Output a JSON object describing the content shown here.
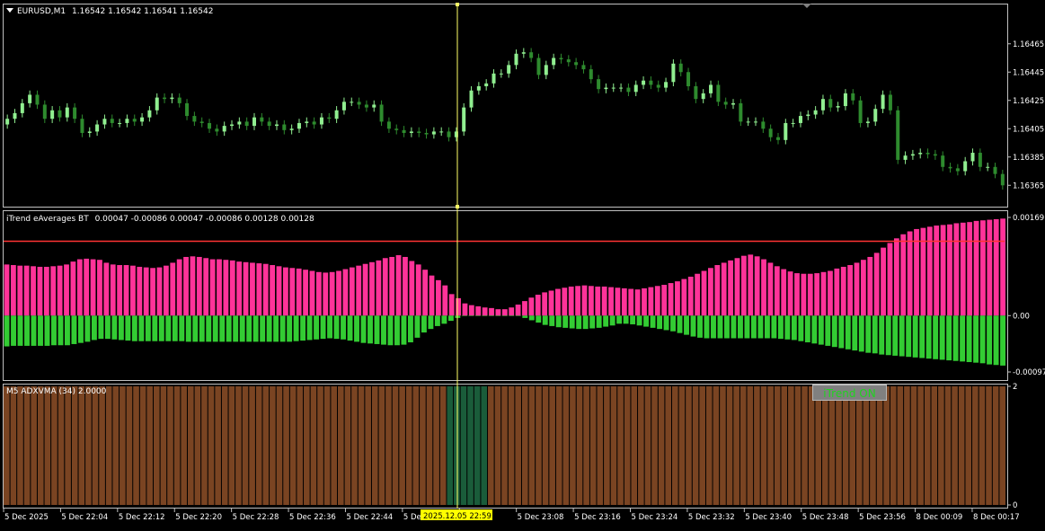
{
  "colors": {
    "background": "#000000",
    "frame": "#c0c0c0",
    "text": "#ffffff",
    "bull_candle": "#90ee90",
    "bear_candle": "#2e8b2e",
    "crosshair": "#ffff66",
    "pink_histogram": "#ff3399",
    "green_histogram": "#33cc33",
    "level_line": "#ff3333",
    "adx_bar": "#7a4422",
    "adx_bar_highlight": "#1a5c3a",
    "button_text": "#1fd41f",
    "time_highlight": "#ffff00"
  },
  "chart_data": [
    {
      "type": "candlestick",
      "symbol": "EURUSD,M1",
      "ohlc_header": "1.16542 1.16542 1.16541 1.16542",
      "ylim": [
        1.16355,
        1.16475
      ],
      "y_ticks": [
        "1.16465",
        "1.16445",
        "1.16425",
        "1.16405",
        "1.16385",
        "1.16365"
      ],
      "close": [
        1.16412,
        1.16416,
        1.16423,
        1.16429,
        1.16422,
        1.16412,
        1.16418,
        1.16413,
        1.1642,
        1.16412,
        1.16402,
        1.16403,
        1.16408,
        1.16412,
        1.16409,
        1.16409,
        1.16412,
        1.1641,
        1.16413,
        1.16418,
        1.16427,
        1.16426,
        1.16427,
        1.16423,
        1.16414,
        1.1641,
        1.16409,
        1.16405,
        1.16403,
        1.16407,
        1.16408,
        1.1641,
        1.16407,
        1.16413,
        1.1641,
        1.16407,
        1.16408,
        1.16404,
        1.16405,
        1.16409,
        1.1641,
        1.16408,
        1.16413,
        1.16412,
        1.16418,
        1.16424,
        1.16424,
        1.16422,
        1.1642,
        1.16422,
        1.1641,
        1.16405,
        1.16404,
        1.16402,
        1.16403,
        1.16402,
        1.16401,
        1.16403,
        1.16403,
        1.16399,
        1.16403,
        1.1642,
        1.16432,
        1.16435,
        1.16437,
        1.16444,
        1.16444,
        1.1645,
        1.16458,
        1.16459,
        1.16455,
        1.16443,
        1.1645,
        1.16455,
        1.16454,
        1.16452,
        1.1645,
        1.16447,
        1.1644,
        1.16433,
        1.16434,
        1.16434,
        1.16434,
        1.16431,
        1.16436,
        1.16439,
        1.16436,
        1.16434,
        1.16438,
        1.16451,
        1.16445,
        1.16435,
        1.16426,
        1.1643,
        1.16436,
        1.16424,
        1.16422,
        1.16423,
        1.1641,
        1.1641,
        1.1641,
        1.16405,
        1.16399,
        1.16397,
        1.16409,
        1.16409,
        1.16414,
        1.16415,
        1.16418,
        1.16426,
        1.1642,
        1.16421,
        1.1643,
        1.16425,
        1.16409,
        1.1641,
        1.16419,
        1.16429,
        1.16418,
        1.16383,
        1.16386,
        1.16387,
        1.16388,
        1.16387,
        1.16386,
        1.16378,
        1.16377,
        1.16375,
        1.16382,
        1.16388,
        1.16378,
        1.16378,
        1.16373,
        1.16365
      ]
    },
    {
      "type": "bar",
      "indicator": "iTrend eAverages BT",
      "values_header": "0.00047 -0.00086 0.00047 -0.00086 0.00128 0.00128",
      "ylim": [
        -0.00097,
        0.00169
      ],
      "y_ticks": [
        "0.00169",
        "0.00",
        "-0.00097"
      ],
      "level_line": 0.00128,
      "series": [
        {
          "values": [
            0.00088,
            0.00087,
            0.00086,
            0.00086,
            0.00085,
            0.00084,
            0.00084,
            0.00085,
            0.00086,
            0.00088,
            0.00093,
            0.00097,
            0.00098,
            0.00097,
            0.00096,
            0.00091,
            0.00088,
            0.00087,
            0.00087,
            0.00086,
            0.00084,
            0.00083,
            0.00082,
            0.00083,
            0.00086,
            0.00091,
            0.00097,
            0.00101,
            0.00102,
            0.00101,
            0.00099,
            0.00097,
            0.00097,
            0.00096,
            0.00095,
            0.00093,
            0.00092,
            0.00091,
            0.0009,
            0.00089,
            0.00087,
            0.00085,
            0.00083,
            0.00082,
            0.00081,
            0.00079,
            0.00077,
            0.00075,
            0.00074,
            0.00075,
            0.00077,
            0.0008,
            0.00083,
            0.00086,
            0.00089,
            0.00092,
            0.00095,
            0.00099,
            0.00101,
            0.00104,
            0.00101,
            0.00094,
            0.00088,
            0.00079,
            0.00069,
            0.00061,
            0.00052,
            0.00037,
            0.0003,
            0.00021,
            0.00018,
            0.00016,
            0.00014,
            0.00013,
            0.00011,
            0.00011,
            0.00014,
            0.00019,
            0.00025,
            0.00031,
            0.00036,
            0.0004,
            0.00043,
            0.00046,
            0.00048,
            0.0005,
            0.00051,
            0.00052,
            0.00051,
            0.0005,
            0.0005,
            0.00049,
            0.00048,
            0.00047,
            0.00046,
            0.00045,
            0.00047,
            0.00049,
            0.00051,
            0.00053,
            0.00056,
            0.00059,
            0.00063,
            0.00067,
            0.00072,
            0.00077,
            0.00082,
            0.00087,
            0.00091,
            0.00095,
            0.00099,
            0.00103,
            0.00105,
            0.00102,
            0.00097,
            0.00091,
            0.00085,
            0.0008,
            0.00076,
            0.00073,
            0.00072,
            0.00072,
            0.00073,
            0.00075,
            0.00077,
            0.00081,
            0.00084,
            0.00087,
            0.00091,
            0.00096,
            0.00101,
            0.00108,
            0.00117,
            0.00125,
            0.00133,
            0.0014,
            0.00145,
            0.00149,
            0.00151,
            0.00153,
            0.00155,
            0.00156,
            0.00157,
            0.00159,
            0.0016,
            0.00161,
            0.00163,
            0.00164,
            0.00165,
            0.00166,
            0.00167
          ]
        },
        {
          "values": [
            -0.00053,
            -0.00052,
            -0.00052,
            -0.00052,
            -0.00052,
            -0.00052,
            -0.00052,
            -0.00051,
            -0.00051,
            -0.00051,
            -0.00049,
            -0.00047,
            -0.00045,
            -0.00042,
            -0.0004,
            -0.0004,
            -0.00041,
            -0.00042,
            -0.00043,
            -0.00044,
            -0.00044,
            -0.00044,
            -0.00044,
            -0.00044,
            -0.00044,
            -0.00044,
            -0.00044,
            -0.00045,
            -0.00045,
            -0.00045,
            -0.00045,
            -0.00045,
            -0.00045,
            -0.00045,
            -0.00045,
            -0.00045,
            -0.00045,
            -0.00045,
            -0.00045,
            -0.00045,
            -0.00045,
            -0.00045,
            -0.00045,
            -0.00044,
            -0.00043,
            -0.00042,
            -0.00041,
            -0.0004,
            -0.00039,
            -0.0004,
            -0.00041,
            -0.00043,
            -0.00045,
            -0.00047,
            -0.00048,
            -0.00049,
            -0.0005,
            -0.00051,
            -0.00051,
            -0.0005,
            -0.00046,
            -0.00038,
            -0.00029,
            -0.00023,
            -0.00018,
            -0.00014,
            -9e-05,
            -4e-05,
            0.0,
            0.0,
            0.0,
            0.0,
            0.0,
            0.0,
            0.0,
            0.0,
            0.0,
            -4e-05,
            -8e-05,
            -0.00012,
            -0.00016,
            -0.00018,
            -0.0002,
            -0.00021,
            -0.00022,
            -0.00023,
            -0.00023,
            -0.00022,
            -0.00021,
            -0.00019,
            -0.00017,
            -0.00014,
            -0.00014,
            -0.00015,
            -0.00017,
            -0.00019,
            -0.00021,
            -0.00023,
            -0.00025,
            -0.00027,
            -0.0003,
            -0.00033,
            -0.00036,
            -0.00038,
            -0.00039,
            -0.00039,
            -0.00039,
            -0.00039,
            -0.00039,
            -0.00039,
            -0.00039,
            -0.00039,
            -0.00039,
            -0.00039,
            -0.00039,
            -0.0004,
            -0.00041,
            -0.00042,
            -0.00044,
            -0.00046,
            -0.00048,
            -0.0005,
            -0.00052,
            -0.00054,
            -0.00056,
            -0.00058,
            -0.0006,
            -0.00062,
            -0.00064,
            -0.00065,
            -0.00067,
            -0.00068,
            -0.00069,
            -0.0007,
            -0.00071,
            -0.00072,
            -0.00073,
            -0.00074,
            -0.00075,
            -0.00076,
            -0.00077,
            -0.00078,
            -0.00079,
            -0.0008,
            -0.00081,
            -0.00082,
            -0.00084,
            -0.00085,
            -0.00086
          ]
        }
      ]
    },
    {
      "type": "bar",
      "indicator": "M5 ADXVMA (34) 2.0000",
      "ylim": [
        0,
        2
      ],
      "y_ticks": [
        "2",
        "0"
      ],
      "bar_count": 147,
      "highlight_range": [
        65,
        70
      ]
    }
  ],
  "x_axis": {
    "labels": [
      "5 Dec 2025",
      "5 Dec 22:04",
      "5 Dec 22:12",
      "5 Dec 22:20",
      "5 Dec 22:28",
      "5 Dec 22:36",
      "5 Dec 22:44",
      "5 Dec 22:5",
      "23:00",
      "5 Dec 23:08",
      "5 Dec 23:16",
      "5 Dec 23:24",
      "5 Dec 23:32",
      "5 Dec 23:40",
      "5 Dec 23:48",
      "5 Dec 23:56",
      "8 Dec 00:09",
      "8 Dec 00:17"
    ],
    "crosshair_time": "2025.12.05 22:59"
  },
  "button": {
    "label": "iTrend ON"
  }
}
